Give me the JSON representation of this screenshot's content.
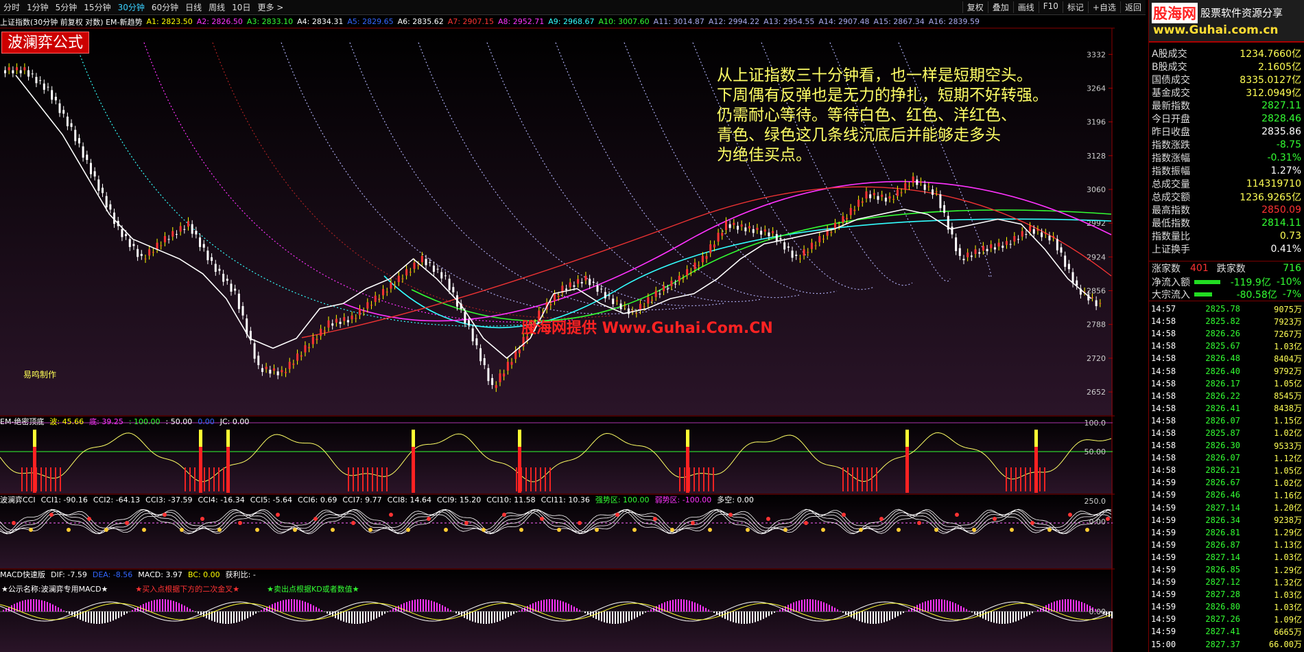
{
  "toolbar": {
    "timeframes": [
      "分时",
      "1分钟",
      "5分钟",
      "15分钟",
      "30分钟",
      "60分钟",
      "日线",
      "周线",
      "10日",
      "更多 >"
    ],
    "active_timeframe": "30分钟",
    "right_buttons": [
      "复权",
      "叠加",
      "画线",
      "F10",
      "标记",
      "+自选",
      "返回"
    ]
  },
  "main_chart": {
    "title": "上证指数(30分钟 前复权 对数) EM-新趋势",
    "ma_labels": [
      {
        "text": "A1: 2823.50",
        "color": "#ffff00"
      },
      {
        "text": "A2: 2826.50",
        "color": "#ff33ff"
      },
      {
        "text": "A3: 2833.10",
        "color": "#33ff33"
      },
      {
        "text": "A4: 2834.31",
        "color": "#ffffff"
      },
      {
        "text": "A5: 2829.65",
        "color": "#3366ff"
      },
      {
        "text": "A6: 2835.62",
        "color": "#ffffff"
      },
      {
        "text": "A7: 2907.15",
        "color": "#ff3333"
      },
      {
        "text": "A8: 2952.71",
        "color": "#ff33ff"
      },
      {
        "text": "A9: 2968.67",
        "color": "#33ffff"
      },
      {
        "text": "A10: 3007.60",
        "color": "#33ff33"
      },
      {
        "text": "A11: 3014.87",
        "color": "#aaaaee"
      },
      {
        "text": "A12: 2994.22",
        "color": "#aaaaee"
      },
      {
        "text": "A13: 2954.55",
        "color": "#aaaaee"
      },
      {
        "text": "A14: 2907.48",
        "color": "#aaaaee"
      },
      {
        "text": "A15: 2867.34",
        "color": "#aaaaee"
      },
      {
        "text": "A16: 2839.59",
        "color": "#aaaaee"
      }
    ],
    "formula_badge": "波澜弈公式",
    "annotation_lines": [
      "从上证指数三十分钟看，也一样是短期空头。",
      "下周偶有反弹也是无力的挣扎，短期不好转强。",
      "仍需耐心等待。等待白色、红色、洋红色、",
      "青色、绿色这几条线沉底后并能够走多头",
      "为绝佳买点。"
    ],
    "watermark": "股海网提供 Www.Guhai.Com.CN",
    "maker_label": "易鸣制作",
    "y_axis_ticks": [
      "3332",
      "3264",
      "3196",
      "3128",
      "3060",
      "2992",
      "2924",
      "2856",
      "2788",
      "2720",
      "2652"
    ]
  },
  "pane2": {
    "labels": [
      {
        "text": "EM-绝密顶底",
        "color": "#ffffff"
      },
      {
        "text": "波: 45.66",
        "color": "#ffff00"
      },
      {
        "text": "底: 39.25",
        "color": "#ff33ff"
      },
      {
        "text": ": 100.00",
        "color": "#33ff33"
      },
      {
        "text": ": 50.00",
        "color": "#ffffff"
      },
      {
        "text": "0.00",
        "color": "#3366ff"
      },
      {
        "text": "JC: 0.00",
        "color": "#ffffff"
      }
    ],
    "y_axis_ticks": [
      "100.0",
      "50.00"
    ]
  },
  "pane3": {
    "labels": [
      {
        "text": "波澜弈CCI",
        "color": "#ffffff"
      },
      {
        "text": "CCI1: -90.16",
        "color": "#ffffff"
      },
      {
        "text": "CCI2: -64.13",
        "color": "#ffffff"
      },
      {
        "text": "CCI3: -37.59",
        "color": "#ffffff"
      },
      {
        "text": "CCI4: -16.34",
        "color": "#ffffff"
      },
      {
        "text": "CCI5: -5.64",
        "color": "#ffffff"
      },
      {
        "text": "CCI6: 0.69",
        "color": "#ffffff"
      },
      {
        "text": "CCI7: 9.77",
        "color": "#ffffff"
      },
      {
        "text": "CCI8: 14.64",
        "color": "#ffffff"
      },
      {
        "text": "CCI9: 15.20",
        "color": "#ffffff"
      },
      {
        "text": "CCI10: 11.58",
        "color": "#ffffff"
      },
      {
        "text": "CCI11: 10.36",
        "color": "#ffffff"
      },
      {
        "text": "强势区: 100.00",
        "color": "#33ff33"
      },
      {
        "text": "弱势区: -100.00",
        "color": "#ff33ff"
      },
      {
        "text": "多空: 0.00",
        "color": "#ffffff"
      }
    ],
    "y_axis_ticks": [
      "250.0",
      "0.00"
    ]
  },
  "pane4": {
    "labels": [
      {
        "text": "MACD快速版",
        "color": "#ffffff"
      },
      {
        "text": "DIF: -7.59",
        "color": "#ffffff"
      },
      {
        "text": "DEA: -8.56",
        "color": "#3366ff"
      },
      {
        "text": "MACD: 3.97",
        "color": "#ffffff"
      },
      {
        "text": "BC: 0.00",
        "color": "#ffff00"
      },
      {
        "text": "获利比: -",
        "color": "#ffffff"
      }
    ],
    "notes": [
      {
        "text": "★公示名称:波澜弈专用MACD★",
        "color": "#ffffff"
      },
      {
        "text": "★买入点根据下方的二次金叉★",
        "color": "#ff3333"
      },
      {
        "text": "★卖出点根据KD或者数值★",
        "color": "#33ff33"
      }
    ],
    "y_axis_ticks": [
      "0.00"
    ]
  },
  "side_panel": {
    "logo_main": "股海网",
    "logo_sub": "股票软件资源分享",
    "logo_url": "www.Guhai.com.cn",
    "stats": [
      {
        "label": "A股成交",
        "value": "1234.7660亿",
        "color": "#ffff55"
      },
      {
        "label": "B股成交",
        "value": "2.1605亿",
        "color": "#ffff55"
      },
      {
        "label": "国债成交",
        "value": "8335.0127亿",
        "color": "#ffff55"
      },
      {
        "label": "基金成交",
        "value": "312.0949亿",
        "color": "#ffff55"
      },
      {
        "label": "最新指数",
        "value": "2827.11",
        "color": "#33ff33"
      },
      {
        "label": "今日开盘",
        "value": "2828.46",
        "color": "#33ff33"
      },
      {
        "label": "昨日收盘",
        "value": "2835.86",
        "color": "#ffffff"
      },
      {
        "label": "指数涨跌",
        "value": "-8.75",
        "color": "#33ff33"
      },
      {
        "label": "指数涨幅",
        "value": "-0.31%",
        "color": "#33ff33"
      },
      {
        "label": "指数振幅",
        "value": "1.27%",
        "color": "#ffffff"
      },
      {
        "label": "总成交量",
        "value": "114319710",
        "color": "#ffff55"
      },
      {
        "label": "总成交额",
        "value": "1236.9265亿",
        "color": "#ffff55"
      },
      {
        "label": "最高指数",
        "value": "2850.09",
        "color": "#ff3333"
      },
      {
        "label": "最低指数",
        "value": "2814.11",
        "color": "#33ff33"
      },
      {
        "label": "指数量比",
        "value": "0.73",
        "color": "#ffff55"
      },
      {
        "label": "上证换手",
        "value": "0.41%",
        "color": "#ffffff"
      }
    ],
    "adv_label": "涨家数",
    "adv_value": "401",
    "dec_label": "跌家数",
    "dec_value": "716",
    "netflow_label": "净流入额",
    "netflow_value": "-119.9亿",
    "netflow_pct": "-10%",
    "bigflow_label": "大宗流入",
    "bigflow_value": "-80.58亿",
    "bigflow_pct": "-7%",
    "ticks": [
      {
        "time": "14:57",
        "price": "2825.78",
        "vol": "9075万"
      },
      {
        "time": "14:58",
        "price": "2825.82",
        "vol": "7923万"
      },
      {
        "time": "14:58",
        "price": "2826.26",
        "vol": "7267万"
      },
      {
        "time": "14:58",
        "price": "2825.67",
        "vol": "1.03亿"
      },
      {
        "time": "14:58",
        "price": "2826.48",
        "vol": "8404万"
      },
      {
        "time": "14:58",
        "price": "2826.40",
        "vol": "9792万"
      },
      {
        "time": "14:58",
        "price": "2826.17",
        "vol": "1.05亿"
      },
      {
        "time": "14:58",
        "price": "2826.22",
        "vol": "8545万"
      },
      {
        "time": "14:58",
        "price": "2826.41",
        "vol": "8438万"
      },
      {
        "time": "14:58",
        "price": "2826.07",
        "vol": "1.15亿"
      },
      {
        "time": "14:58",
        "price": "2825.87",
        "vol": "1.02亿"
      },
      {
        "time": "14:58",
        "price": "2826.30",
        "vol": "9533万"
      },
      {
        "time": "14:58",
        "price": "2826.07",
        "vol": "1.12亿"
      },
      {
        "time": "14:58",
        "price": "2826.21",
        "vol": "1.05亿"
      },
      {
        "time": "14:59",
        "price": "2826.67",
        "vol": "1.02亿"
      },
      {
        "time": "14:59",
        "price": "2826.46",
        "vol": "1.16亿"
      },
      {
        "time": "14:59",
        "price": "2827.14",
        "vol": "1.20亿"
      },
      {
        "time": "14:59",
        "price": "2826.34",
        "vol": "9238万"
      },
      {
        "time": "14:59",
        "price": "2826.81",
        "vol": "1.29亿"
      },
      {
        "time": "14:59",
        "price": "2826.87",
        "vol": "1.13亿"
      },
      {
        "time": "14:59",
        "price": "2827.14",
        "vol": "1.03亿"
      },
      {
        "time": "14:59",
        "price": "2826.85",
        "vol": "1.29亿"
      },
      {
        "time": "14:59",
        "price": "2827.12",
        "vol": "1.32亿"
      },
      {
        "time": "14:59",
        "price": "2827.28",
        "vol": "1.03亿"
      },
      {
        "time": "14:59",
        "price": "2826.80",
        "vol": "1.03亿"
      },
      {
        "time": "14:59",
        "price": "2827.26",
        "vol": "1.09亿"
      },
      {
        "time": "14:59",
        "price": "2827.41",
        "vol": "6665万"
      },
      {
        "time": "15:00",
        "price": "2827.37",
        "vol": "66.00万"
      }
    ]
  },
  "colors": {
    "up": "#ff3333",
    "down": "#33ff33",
    "accent_cyan": "#3ad0ff",
    "volume": "#ffff55",
    "chart_bg_bottom": "#2a1428"
  },
  "chart_data": [
    {
      "type": "line",
      "title": "上证指数(30分钟 前复权 对数)",
      "ylim": [
        2630,
        3360
      ],
      "series": [
        {
          "name": "A4",
          "values": [
            3290,
            3230,
            3170,
            3090,
            3010,
            2960,
            2940,
            2920,
            2890,
            2840,
            2760,
            2740,
            2760,
            2820,
            2830,
            2860,
            2880,
            2920,
            2880,
            2830,
            2760,
            2720,
            2760,
            2850,
            2860,
            2830,
            2810,
            2820,
            2840,
            2850,
            2880,
            2920,
            2950,
            2960,
            2970,
            2980,
            3000,
            3010,
            3020,
            3010,
            2980,
            2990,
            3000,
            2990,
            2940,
            2880,
            2840
          ]
        }
      ],
      "close": [
        3300,
        3260,
        3180,
        3080,
        2980,
        2920,
        2960,
        2990,
        2910,
        2850,
        2700,
        2690,
        2740,
        2790,
        2800,
        2840,
        2880,
        2920,
        2880,
        2780,
        2660,
        2730,
        2810,
        2860,
        2880,
        2840,
        2810,
        2850,
        2880,
        2920,
        2990,
        2980,
        2970,
        2920,
        2960,
        3000,
        3050,
        3040,
        3080,
        3050,
        2920,
        2940,
        2950,
        2980,
        2960,
        2860,
        2825
      ]
    }
  ]
}
